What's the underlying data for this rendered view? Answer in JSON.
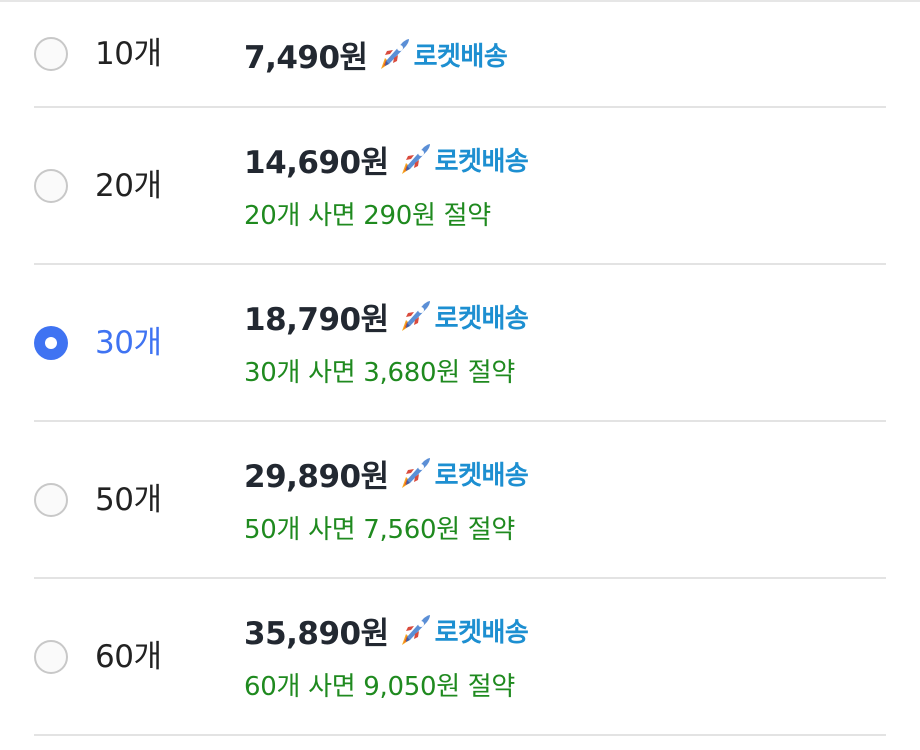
{
  "colors": {
    "selected": "#3f73f2",
    "saving": "#1f8a1f",
    "delivery": "#1d8fd1",
    "price": "#222831"
  },
  "delivery_icon": "rocket-icon",
  "options": [
    {
      "qty": "10개",
      "price": "7,490원",
      "delivery": "로켓배송",
      "saving": "",
      "selected": false
    },
    {
      "qty": "20개",
      "price": "14,690원",
      "delivery": "로켓배송",
      "saving": "20개 사면 290원 절약",
      "selected": false
    },
    {
      "qty": "30개",
      "price": "18,790원",
      "delivery": "로켓배송",
      "saving": "30개 사면 3,680원 절약",
      "selected": true
    },
    {
      "qty": "50개",
      "price": "29,890원",
      "delivery": "로켓배송",
      "saving": "50개 사면 7,560원 절약",
      "selected": false
    },
    {
      "qty": "60개",
      "price": "35,890원",
      "delivery": "로켓배송",
      "saving": "60개 사면 9,050원 절약",
      "selected": false
    }
  ]
}
